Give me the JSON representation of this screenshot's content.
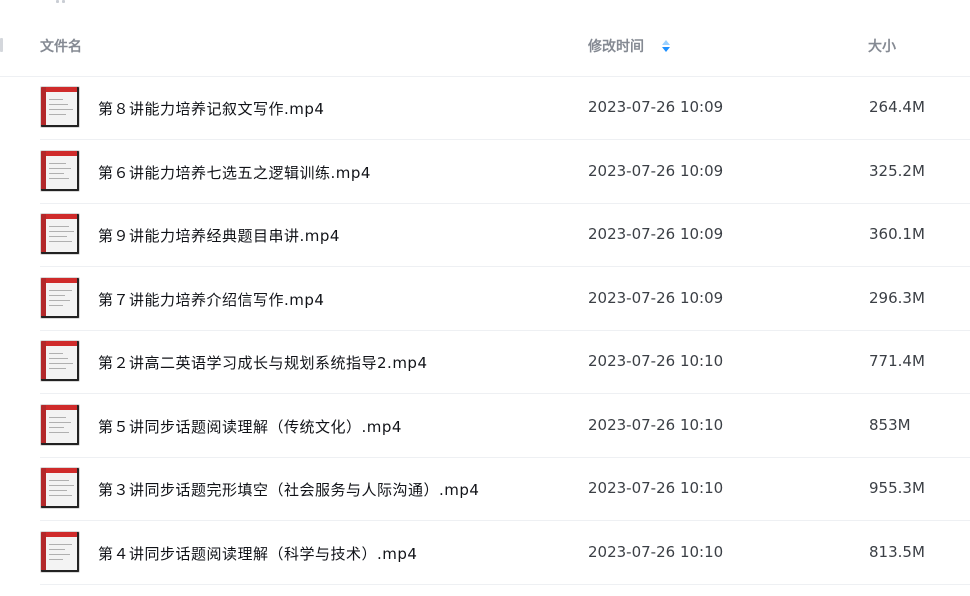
{
  "header": {
    "name_label": "文件名",
    "time_label": "修改时间",
    "size_label": "大小",
    "sort_icon": "sort-desc-icon",
    "sort_colors": {
      "active": "#1e90ff",
      "inactive": "#9ad0ff"
    }
  },
  "files": [
    {
      "name": "第８讲能力培养记叙文写作.mp4",
      "modified": "2023-07-26 10:09",
      "size": "264.4M",
      "icon": "video-thumbnail"
    },
    {
      "name": "第６讲能力培养七选五之逻辑训练.mp4",
      "modified": "2023-07-26 10:09",
      "size": "325.2M",
      "icon": "video-thumbnail"
    },
    {
      "name": "第９讲能力培养经典题目串讲.mp4",
      "modified": "2023-07-26 10:09",
      "size": "360.1M",
      "icon": "video-thumbnail"
    },
    {
      "name": "第７讲能力培养介绍信写作.mp4",
      "modified": "2023-07-26 10:09",
      "size": "296.3M",
      "icon": "video-thumbnail"
    },
    {
      "name": "第２讲高二英语学习成长与规划系统指导2.mp4",
      "modified": "2023-07-26 10:10",
      "size": "771.4M",
      "icon": "video-thumbnail"
    },
    {
      "name": "第５讲同步话题阅读理解（传统文化）.mp4",
      "modified": "2023-07-26 10:10",
      "size": "853M",
      "icon": "video-thumbnail"
    },
    {
      "name": "第３讲同步话题完形填空（社会服务与人际沟通）.mp4",
      "modified": "2023-07-26 10:10",
      "size": "955.3M",
      "icon": "video-thumbnail"
    },
    {
      "name": "第４讲同步话题阅读理解（科学与技术）.mp4",
      "modified": "2023-07-26 10:10",
      "size": "813.5M",
      "icon": "video-thumbnail"
    }
  ]
}
